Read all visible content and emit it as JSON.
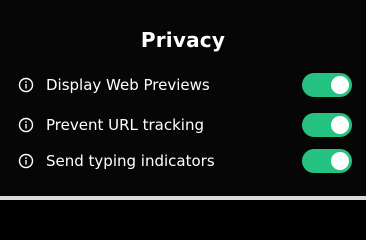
{
  "page": {
    "title": "Privacy"
  },
  "settings": {
    "items": [
      {
        "label": "Display Web Previews",
        "icon": "info-icon",
        "enabled": true
      },
      {
        "label": "Prevent URL tracking",
        "icon": "info-icon",
        "enabled": true
      },
      {
        "label": "Send typing indicators",
        "icon": "info-icon",
        "enabled": true
      }
    ]
  },
  "colors": {
    "background": "#060606",
    "toggle_on": "#26c281",
    "text": "#ffffff"
  }
}
